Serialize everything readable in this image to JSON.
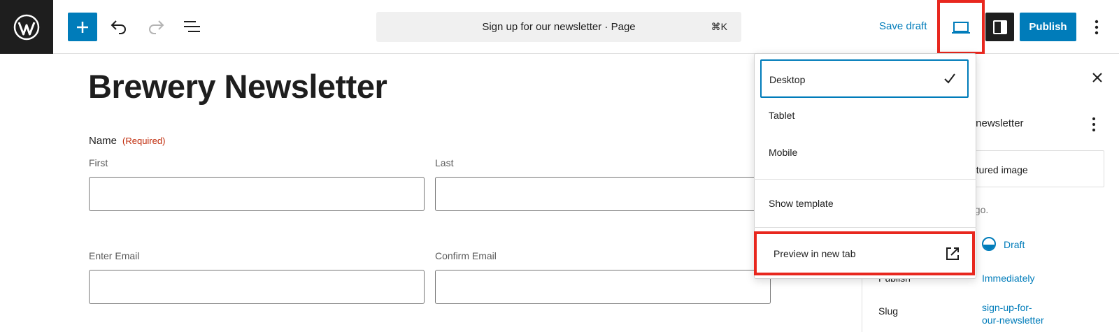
{
  "toolbar": {
    "logo": "wordpress-logo",
    "add_block_icon": "plus-icon",
    "undo_icon": "undo-icon",
    "redo_icon": "redo-icon",
    "list_view_icon": "list-view-icon",
    "document_title": "Sign up for our newsletter · Page",
    "command_shortcut": "⌘K",
    "save_draft_label": "Save draft",
    "view_icon": "desktop-laptop-icon",
    "settings_icon": "sidebar-settings-icon",
    "publish_label": "Publish",
    "options_icon": "more-vertical-icon"
  },
  "colors": {
    "accent": "#007cba",
    "highlight": "#e8271e",
    "required": "#c02b0a",
    "dark": "#1e1e1e"
  },
  "editor": {
    "page_title": "Brewery Newsletter",
    "name_field": {
      "label": "Name",
      "required_text": "(Required)",
      "first_label": "First",
      "last_label": "Last",
      "first_value": "",
      "last_value": ""
    },
    "email_field": {
      "enter_label": "Enter Email",
      "confirm_label": "Confirm Email",
      "enter_value": "",
      "confirm_value": ""
    }
  },
  "sidebar": {
    "close_icon": "close-icon",
    "page_name_partial": "r newsletter",
    "featured_image_partial": "atured image",
    "last_edited_partial": "ago.",
    "status_value": "Draft",
    "publish_label": "Publish",
    "publish_value": "Immediately",
    "slug_label": "Slug",
    "slug_value_line1": "sign-up-for-",
    "slug_value_line2": "our-newsletter"
  },
  "view_menu": {
    "items": [
      {
        "label": "Desktop",
        "selected": true
      },
      {
        "label": "Tablet",
        "selected": false
      },
      {
        "label": "Mobile",
        "selected": false
      }
    ],
    "show_template_label": "Show template",
    "preview_label": "Preview in new tab",
    "preview_icon": "external-link-icon",
    "check_icon": "check-icon"
  }
}
